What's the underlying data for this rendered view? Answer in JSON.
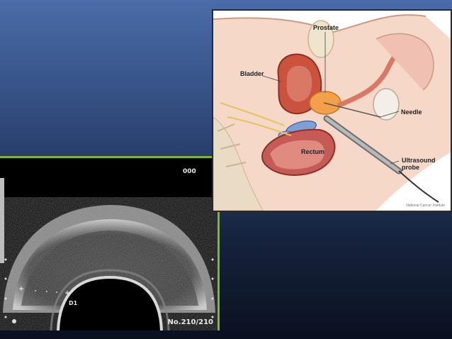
{
  "ultrasound": {
    "frame_counter": "000",
    "frame_number": "No.210/210",
    "marker": "D1"
  },
  "anatomy": {
    "labels": {
      "prostate": "Prostate",
      "bladder": "Bladder",
      "needle": "Needle",
      "rectum": "Rectum",
      "probe_line1": "Ultrasound",
      "probe_line2": "probe"
    },
    "credit": "National Cancer Institute"
  },
  "colors": {
    "frame_border": "#7ab832",
    "background_top": "#4a6ca8",
    "background_bottom": "#0a1020"
  }
}
